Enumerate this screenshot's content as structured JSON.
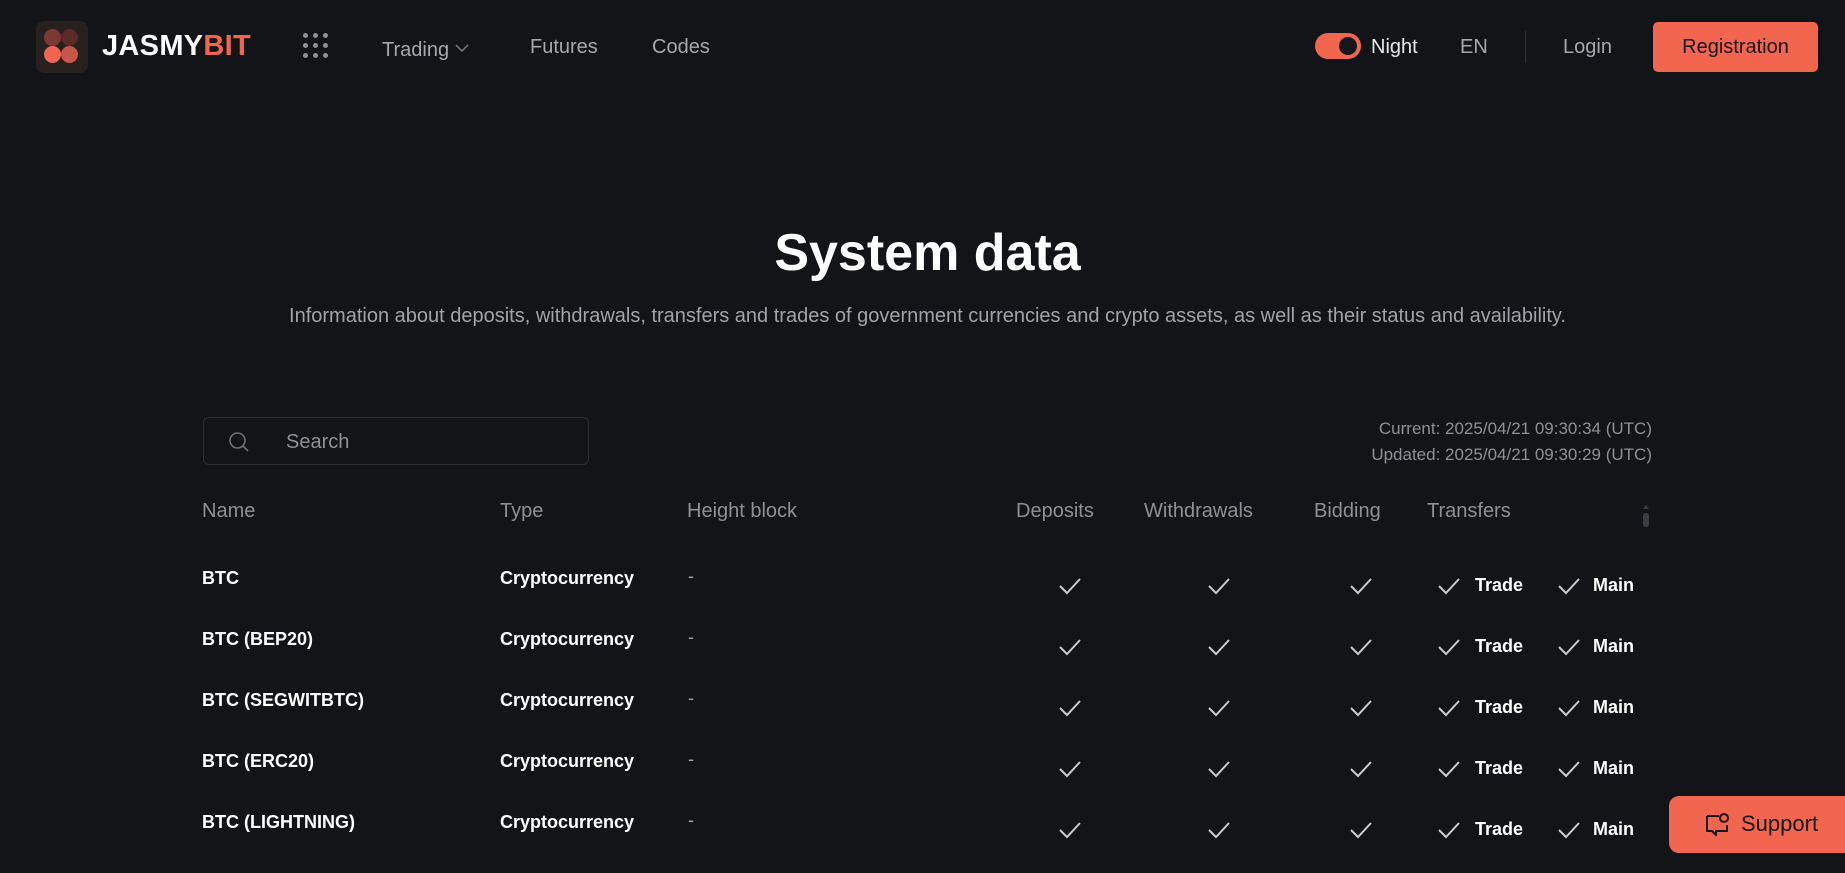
{
  "header": {
    "brand_part1": "JASMY",
    "brand_part2": "BIT",
    "nav": {
      "trading": "Trading",
      "futures": "Futures",
      "codes": "Codes"
    },
    "theme_label": "Night",
    "theme_on": true,
    "language": "EN",
    "login": "Login",
    "registration": "Registration"
  },
  "hero": {
    "title": "System data",
    "subtitle": "Information about deposits, withdrawals, transfers and trades of government currencies and crypto assets, as well as their status and availability."
  },
  "search": {
    "placeholder": "Search",
    "value": ""
  },
  "times": {
    "current": "Current: 2025/04/21 09:30:34 (UTC)",
    "updated": "Updated: 2025/04/21 09:30:29 (UTC)"
  },
  "table": {
    "columns": {
      "name": "Name",
      "type": "Type",
      "height": "Height block",
      "deposits": "Deposits",
      "withdrawals": "Withdrawals",
      "bidding": "Bidding",
      "transfers": "Transfers"
    },
    "rows": [
      {
        "name": "BTC",
        "type": "Cryptocurrency",
        "height": "-",
        "trade": "Trade",
        "main": "Main"
      },
      {
        "name": "BTC (BEP20)",
        "type": "Cryptocurrency",
        "height": "-",
        "trade": "Trade",
        "main": "Main"
      },
      {
        "name": "BTC (SEGWITBTC)",
        "type": "Cryptocurrency",
        "height": "-",
        "trade": "Trade",
        "main": "Main"
      },
      {
        "name": "BTC (ERC20)",
        "type": "Cryptocurrency",
        "height": "-",
        "trade": "Trade",
        "main": "Main"
      },
      {
        "name": "BTC (LIGHTNING)",
        "type": "Cryptocurrency",
        "height": "-",
        "trade": "Trade",
        "main": "Main"
      }
    ]
  },
  "support": {
    "label": "Support"
  },
  "colors": {
    "accent": "#f2654f",
    "background": "#131417",
    "muted_text": "#8e9095"
  },
  "icons": {
    "logo": "logo-mark",
    "apps": "grid-dots-icon",
    "trading_chevron": "chevron-down-icon",
    "search": "search-icon",
    "status": "check-icon",
    "support": "chat-bubble-icon"
  }
}
